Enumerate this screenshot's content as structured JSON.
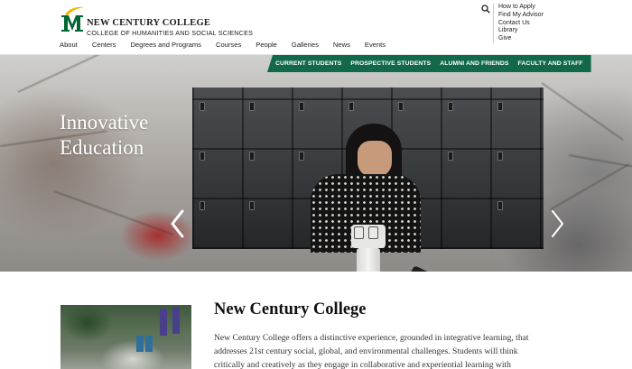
{
  "colors": {
    "brand_green": "#11694a",
    "logo_gold": "#f2b600",
    "logo_green": "#006633"
  },
  "header": {
    "logo_icon": "gmu-m-logo",
    "college_name": "NEW CENTURY COLLEGE",
    "college_subtitle": "COLLEGE OF HUMANITIES AND SOCIAL SCIENCES",
    "search_icon": "search-icon",
    "utility_links": [
      "How to Apply",
      "Find My Advisor",
      "Contact Us",
      "Library",
      "Give"
    ],
    "nav": [
      "About",
      "Centers",
      "Degrees and Programs",
      "Courses",
      "People",
      "Galleries",
      "News",
      "Events"
    ]
  },
  "hero": {
    "audience_links": [
      "CURRENT STUDENTS",
      "PROSPECTIVE STUDENTS",
      "ALUMNI AND FRIENDS",
      "FACULTY AND STAFF"
    ],
    "title_line1": "Innovative",
    "title_line2": "Education",
    "prev_icon": "chevron-left-icon",
    "next_icon": "chevron-right-icon"
  },
  "intro": {
    "title": "New Century College",
    "body": "New Century College offers a distinctive experience, grounded in integrative learning, that addresses 21st century social, global, and environmental challenges. Students will think critically and creatively as they engage in collaborative and experiential learning with"
  }
}
